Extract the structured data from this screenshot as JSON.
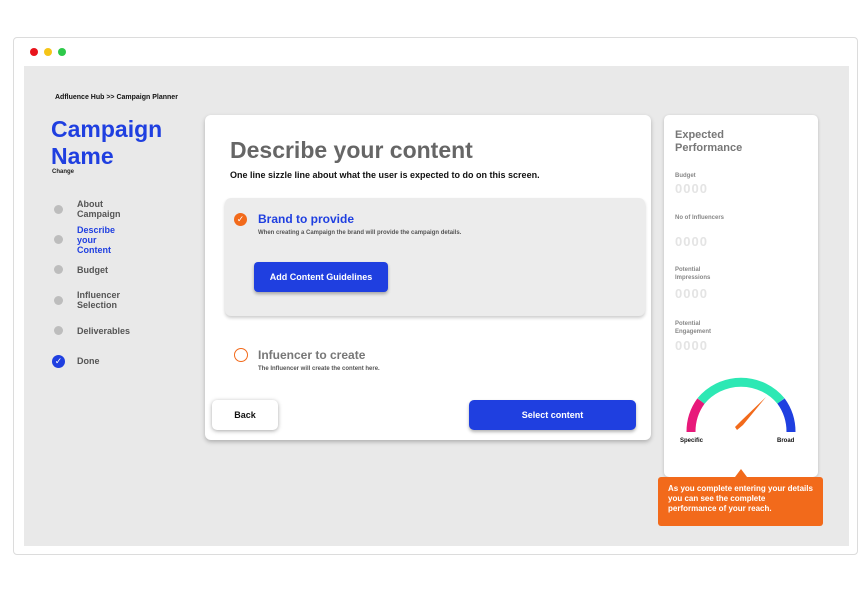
{
  "window": {
    "dot_colors": [
      "#e8141c",
      "#f5c518",
      "#2ec94a"
    ]
  },
  "breadcrumb": "Adfluence Hub >> Campaign Planner",
  "campaign": {
    "name": "Campaign Name",
    "change_label": "Change"
  },
  "steps": [
    {
      "label": "About Campaign",
      "state": "pending"
    },
    {
      "label": "Describe your Content",
      "state": "active"
    },
    {
      "label": "Budget",
      "state": "pending"
    },
    {
      "label": "Influencer Selection",
      "state": "pending"
    },
    {
      "label": "Deliverables",
      "state": "pending"
    },
    {
      "label": "Done",
      "state": "done",
      "icon": "check-icon"
    }
  ],
  "main": {
    "title": "Describe your content",
    "subtitle": "One line sizzle line about what the user is expected to do on this screen.",
    "option_brand": {
      "title": "Brand to provide",
      "description": "When creating a Campaign the brand will provide the campaign details.",
      "button_label": "Add Content Guidelines",
      "selected": true
    },
    "option_influencer": {
      "title": "Infuencer to create",
      "description": "The Influencer will create the content here.",
      "selected": false
    },
    "back_label": "Back",
    "select_label": "Select content"
  },
  "performance": {
    "title": "Expected Performance",
    "metrics": [
      {
        "label": "Budget",
        "value": "0000"
      },
      {
        "label": "No of Influencers",
        "value": "0000"
      },
      {
        "label": "Potential Impressions",
        "value": "0000"
      },
      {
        "label": "Potential Engagement",
        "value": "0000"
      }
    ],
    "gauge": {
      "left_label": "Specific",
      "right_label": "Broad",
      "colors": {
        "left": "#e8197a",
        "middle": "#2de8b4",
        "right": "#1f3fe0",
        "needle": "#f26a1b"
      }
    }
  },
  "tooltip": "As you complete entering your details you can see the complete performance of your reach.",
  "colors": {
    "accent": "#1f3fe0",
    "orange": "#f26a1b",
    "canvas": "#e9e9e9"
  }
}
